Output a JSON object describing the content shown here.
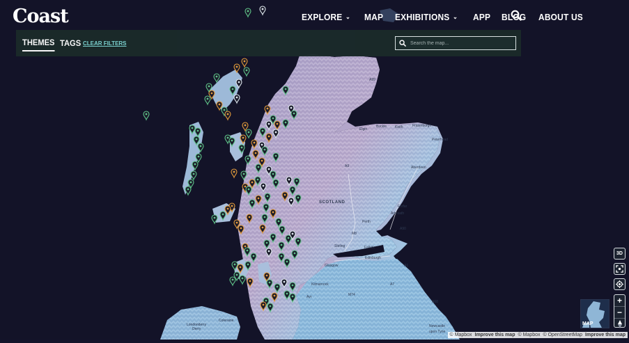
{
  "header": {
    "logo": "Coast",
    "nav": [
      {
        "label": "EXPLORE",
        "dropdown": true
      },
      {
        "label": "MAP",
        "dropdown": false
      },
      {
        "label": "EXHIBITIONS",
        "dropdown": true
      },
      {
        "label": "APP",
        "dropdown": false
      },
      {
        "label": "BLOG",
        "dropdown": false
      },
      {
        "label": "ABOUT US",
        "dropdown": false
      }
    ],
    "search_icon": "search-icon"
  },
  "filters": {
    "themes_label": "THEMES",
    "tags_label": "TAGS",
    "clear_label": "CLEAR FILTERS",
    "search_placeholder": "Search the map..."
  },
  "map": {
    "labels": {
      "scotland": "SCOTLAND",
      "aberdeen": "Aberdeen",
      "fraserburgh": "Fraserburgh",
      "peterhead": "Peterhead",
      "buckie": "Buckie",
      "elgin": "Elgin",
      "keith": "Keith",
      "forfar": "Forfar",
      "arbroath": "Arbroath",
      "perth": "Perth",
      "stirling": "Stirling",
      "falkirk": "Falkirk",
      "edinburgh": "Edinburgh",
      "glasgow": "Glasgow",
      "kilmarnock": "Kilmarnock",
      "ayr": "Ayr",
      "londonderry": "Londonderry",
      "derry": "Derry",
      "coleraine": "Coleraine",
      "newcastle": "Newcastle",
      "upon_tyne": "upon Tyne",
      "road_a99": "A99",
      "road_a9": "A9",
      "road_a90": "A90",
      "road_a1": "A1",
      "road_m8": "M8",
      "road_m74": "M74",
      "road_a68": "A68",
      "road_a7": "A7"
    },
    "controls": {
      "view_3d": "3D",
      "plus": "+",
      "minus": "−",
      "minimap_label": "MAP"
    },
    "attribution": [
      "© Mapbox",
      "Improve this map",
      "© Mapbox",
      "© OpenStreetMap",
      "Improve this map"
    ],
    "colors": {
      "sea": "#131328",
      "land": "#8fb6d6",
      "pin_green": "#5fc48a",
      "pin_orange": "#e39a3b",
      "pin_dark": "#1a1a2a"
    }
  }
}
